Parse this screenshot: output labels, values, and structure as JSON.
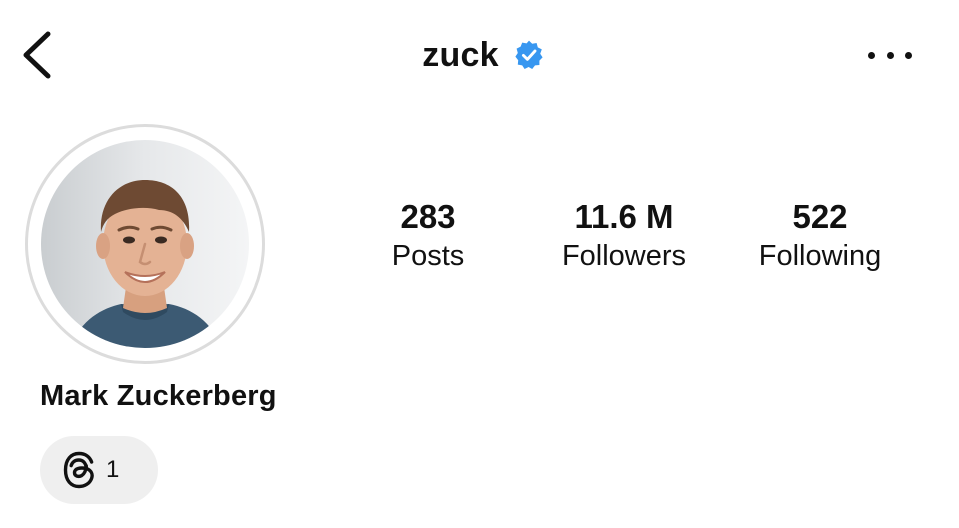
{
  "header": {
    "username": "zuck",
    "back_icon": "chevron-left-icon",
    "verified_icon": "verified-badge-icon",
    "verified_color": "#3897f0",
    "more_icon": "more-horizontal-icon"
  },
  "profile": {
    "full_name": "Mark Zuckerberg",
    "avatar": "profile-photo"
  },
  "stats": [
    {
      "value": "283",
      "label": "Posts"
    },
    {
      "value": "11.6 M",
      "label": "Followers"
    },
    {
      "value": "522",
      "label": "Following"
    }
  ],
  "threads_badge": {
    "icon": "threads-logo-icon",
    "count": "1"
  }
}
